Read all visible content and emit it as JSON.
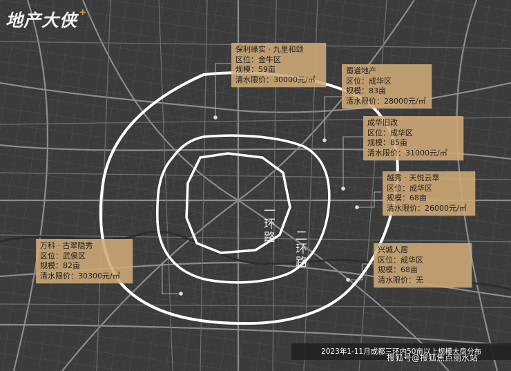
{
  "logo": {
    "text": "地产大侠",
    "accent": "+"
  },
  "ring_labels": {
    "first": "一环路",
    "second": "二环路"
  },
  "cards": [
    {
      "developer": "保利綠实 · 九里和颂",
      "district": "区位：金牛区",
      "scale": "规模：59亩",
      "price": "清水限价：30000元/㎡"
    },
    {
      "developer": "蜀道地产",
      "district": "区位：成华区",
      "scale": "规模：83亩",
      "price": "清水限价：28000元/㎡"
    },
    {
      "developer": "成华旧改",
      "district": "区位：成华区",
      "scale": "规模：85亩",
      "price": "清水限价：31000元/㎡"
    },
    {
      "developer": "越秀 · 天悦云萃",
      "district": "区位：成华区",
      "scale": "规模：68亩",
      "price": "清水限价：26000元/㎡"
    },
    {
      "developer": "兴城人居",
      "district": "区位：成华区",
      "scale": "规模：68亩",
      "price": "清水限价：无"
    },
    {
      "developer": "万科 · 古翠隐秀",
      "district": "区位：武侯区",
      "scale": "规模：82亩",
      "price": "清水限价：30300元/㎡"
    }
  ],
  "caption": "2023年1-11月成都三环内50亩以上规模大盘分布",
  "watermark": "搜狐号@搜狐焦点丽水站",
  "colors": {
    "map_bg": "#3b3b3b",
    "road": "#8a8a8a",
    "ring": "#ffffff",
    "card_bg": "#cfaa78",
    "logo_accent": "#d6a83b"
  }
}
